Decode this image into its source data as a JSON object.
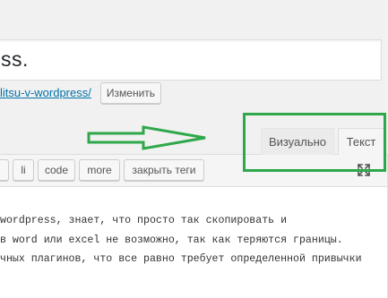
{
  "post": {
    "title_fragment": "ss."
  },
  "permalink": {
    "link_text": "litsu-v-wordpress/",
    "change_button": "Изменить"
  },
  "editor_tabs": {
    "visual": "Визуально",
    "text": "Текст"
  },
  "quicktags": {
    "partial": "",
    "li": "li",
    "code": "code",
    "more": "more",
    "close_tags": "закрыть теги"
  },
  "editor": {
    "lines": [
      "wordpress, знает, что просто так скопировать и",
      "в word или excel не возможно, так как теряются границы.",
      "чных плагинов, что все равно требует определенной привычки"
    ]
  },
  "icons": {
    "fullscreen": "fullscreen-icon",
    "arrow": "arrow-annotation-icon"
  },
  "colors": {
    "annotation_green": "#2ea84a",
    "link_blue": "#0073aa",
    "background": "#f1f1f1"
  }
}
